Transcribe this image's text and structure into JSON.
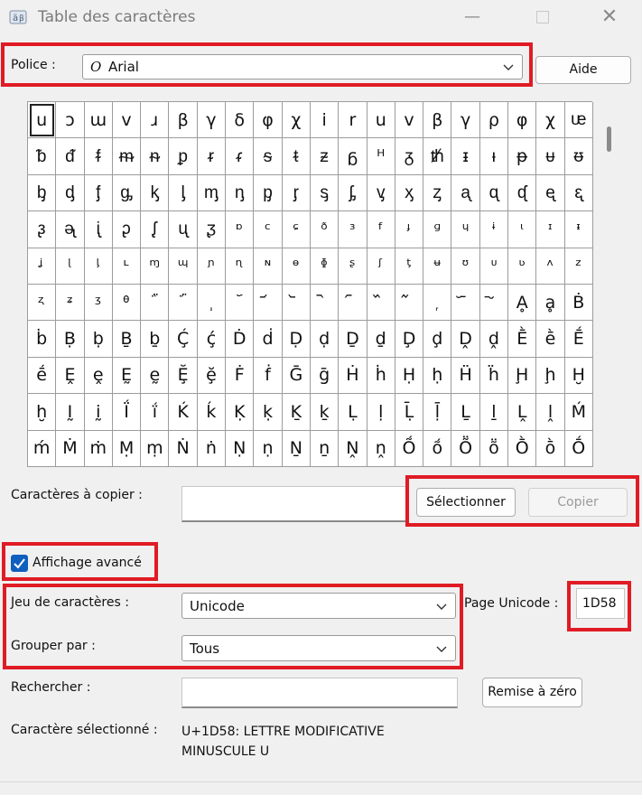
{
  "window": {
    "title": "Table des caractères"
  },
  "font": {
    "label": "Police :",
    "value": "Arial",
    "help_button": "Aide"
  },
  "grid": {
    "rows": [
      [
        "u",
        "ɔ",
        "ɯ",
        "v",
        "ɹ",
        "β",
        "γ",
        "δ",
        "φ",
        "χ",
        "i",
        "r",
        "u",
        "v",
        "β",
        "γ",
        "ρ",
        "φ",
        "χ",
        "ᵫ"
      ],
      [
        "ᵬ",
        "ᵭ",
        "ᵮ",
        "ᵯ",
        "ᵰ",
        "ᵱ",
        "ᵲ",
        "ᵳ",
        "ᵴ",
        "ᵵ",
        "ᵶ",
        "ᵷ",
        "ᵸ",
        "ᵹ",
        "ᵺ",
        "ᵻ",
        "ᵼ",
        "ᵽ",
        "ᵾ",
        "ᵿ"
      ],
      [
        "ᶀ",
        "ᶁ",
        "ᶂ",
        "ᶃ",
        "ᶄ",
        "ᶅ",
        "ᶆ",
        "ᶇ",
        "ᶈ",
        "ᶉ",
        "ᶊ",
        "ᶋ",
        "ᶌ",
        "ᶍ",
        "ᶎ",
        "ᶏ",
        "ᶐ",
        "ᶑ",
        "ᶒ",
        "ᶓ"
      ],
      [
        "ᶔ",
        "ᶕ",
        "ᶖ",
        "ᶗ",
        "ᶘ",
        "ᶙ",
        "ᶚ",
        "ᶛ",
        "ᶜ",
        "ᶝ",
        "ᶞ",
        "ᶟ",
        "ᶠ",
        "ᶡ",
        "ᶢ",
        "ᶣ",
        "ᶤ",
        "ᶥ",
        "ᶦ",
        "ᶧ"
      ],
      [
        "ᶨ",
        "ᶩ",
        "ᶪ",
        "ᶫ",
        "ᶬ",
        "ᶭ",
        "ᶮ",
        "ᶯ",
        "ᶰ",
        "ᶱ",
        "ᶲ",
        "ᶳ",
        "ᶴ",
        "ᶵ",
        "ᶶ",
        "ᶷ",
        "ᶸ",
        "ᶹ",
        "ᶺ",
        "ᶻ"
      ],
      [
        "ᶼ",
        "ᶽ",
        "ᶾ",
        "ᶿ",
        "᷀",
        "᷁",
        "᷂",
        "᷃",
        "᷄",
        "᷅",
        "᷆",
        "᷇",
        "᷈",
        "᷉",
        "᷊",
        "᷋",
        "᷌",
        "Ḁ",
        "ḁ",
        "Ḃ"
      ],
      [
        "ḃ",
        "Ḅ",
        "ḅ",
        "Ḇ",
        "ḇ",
        "Ḉ",
        "ḉ",
        "Ḋ",
        "ḋ",
        "Ḍ",
        "ḍ",
        "Ḏ",
        "ḏ",
        "Ḑ",
        "ḑ",
        "Ḓ",
        "ḓ",
        "Ḕ",
        "ḕ",
        "Ḗ"
      ],
      [
        "ḗ",
        "Ḙ",
        "ḙ",
        "Ḛ",
        "ḛ",
        "Ḝ",
        "ḝ",
        "Ḟ",
        "ḟ",
        "Ḡ",
        "ḡ",
        "Ḣ",
        "ḣ",
        "Ḥ",
        "ḥ",
        "Ḧ",
        "ḧ",
        "Ḩ",
        "ḩ",
        "Ḫ"
      ],
      [
        "ḫ",
        "Ḭ",
        "ḭ",
        "Ḯ",
        "ḯ",
        "Ḱ",
        "ḱ",
        "Ḳ",
        "ḳ",
        "Ḵ",
        "ḵ",
        "Ḷ",
        "ḷ",
        "Ḹ",
        "ḹ",
        "Ḻ",
        "ḻ",
        "Ḽ",
        "ḽ",
        "Ḿ"
      ],
      [
        "ḿ",
        "Ṁ",
        "ṁ",
        "Ṃ",
        "ṃ",
        "Ṅ",
        "ṅ",
        "Ṇ",
        "ṇ",
        "Ṉ",
        "ṉ",
        "Ṋ",
        "ṋ",
        "Ṍ",
        "ṍ",
        "Ṏ",
        "ṏ",
        "Ṑ",
        "ṑ",
        "Ṓ"
      ]
    ]
  },
  "copy": {
    "label": "Caractères à copier :",
    "value": "",
    "select_button": "Sélectionner",
    "copy_button": "Copier"
  },
  "advanced": {
    "label": "Affichage avancé",
    "checked": true
  },
  "charset": {
    "label": "Jeu de caractères :",
    "value": "Unicode"
  },
  "unicode_page": {
    "label": "Page Unicode :",
    "value": "1D58"
  },
  "group_by": {
    "label": "Grouper par :",
    "value": "Tous"
  },
  "search": {
    "label": "Rechercher :",
    "value": "",
    "reset_button": "Remise à zéro"
  },
  "selected": {
    "label": "Caractère sélectionné :",
    "line1": "U+1D58: LETTRE MODIFICATIVE",
    "line2": "MINUSCULE U"
  },
  "colors": {
    "highlight": "#e01b24",
    "checkbox": "#0f5fbf"
  }
}
